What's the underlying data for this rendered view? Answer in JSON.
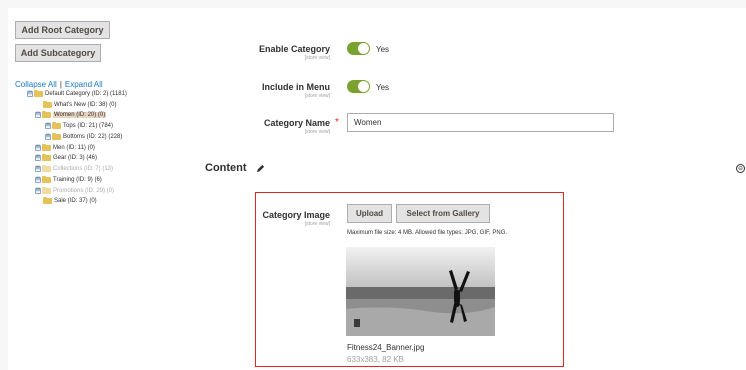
{
  "tree_actions": {
    "add_root": "Add Root Category",
    "add_sub": "Add Subcategory",
    "collapse_all": "Collapse All",
    "separator": "|",
    "expand_all": "Expand All"
  },
  "tree": [
    {
      "label": "Default Category (ID: 2) (1181)",
      "expander": "⊟",
      "state": "normal"
    },
    {
      "label": "What's New (ID: 38) (0)",
      "expander": "",
      "state": "normal"
    },
    {
      "label": "Women (ID: 20) (0)",
      "expander": "⊟",
      "state": "selected"
    },
    {
      "label": "Tops (ID: 21) (784)",
      "expander": "⊞",
      "state": "normal"
    },
    {
      "label": "Bottoms (ID: 22) (228)",
      "expander": "⊞",
      "state": "normal"
    },
    {
      "label": "Men (ID: 11) (0)",
      "expander": "⊞",
      "state": "normal"
    },
    {
      "label": "Gear (ID: 3) (46)",
      "expander": "⊞",
      "state": "normal"
    },
    {
      "label": "Collections (ID: 7) (13)",
      "expander": "⊞",
      "state": "muted"
    },
    {
      "label": "Training (ID: 9) (6)",
      "expander": "⊞",
      "state": "normal"
    },
    {
      "label": "Promotions (ID: 29) (0)",
      "expander": "⊞",
      "state": "muted"
    },
    {
      "label": "Sale (ID: 37) (0)",
      "expander": "",
      "state": "normal"
    }
  ],
  "form": {
    "enable_category": {
      "label": "Enable Category",
      "scope": "[store view]",
      "value": "Yes",
      "on": true
    },
    "include_in_menu": {
      "label": "Include in Menu",
      "scope": "[store view]",
      "value": "Yes",
      "on": true
    },
    "category_name": {
      "label": "Category Name",
      "scope": "[store view]",
      "required_mark": "*",
      "value": "Women"
    }
  },
  "content_section": {
    "title": "Content",
    "pencil_icon": "pencil-icon",
    "collapse_icon": "⊖"
  },
  "category_image": {
    "label": "Category Image",
    "scope": "[store view]",
    "upload_label": "Upload",
    "gallery_label": "Select from Gallery",
    "note": "Maximum file size: 4 MB. Allowed file types: JPG, GIF, PNG.",
    "file_name": "Fitness24_Banner.jpg",
    "file_meta": "633x383, 82 KB"
  },
  "colors": {
    "toggle_on": "#79a22e",
    "required": "#e22626",
    "link": "#1979c3"
  }
}
